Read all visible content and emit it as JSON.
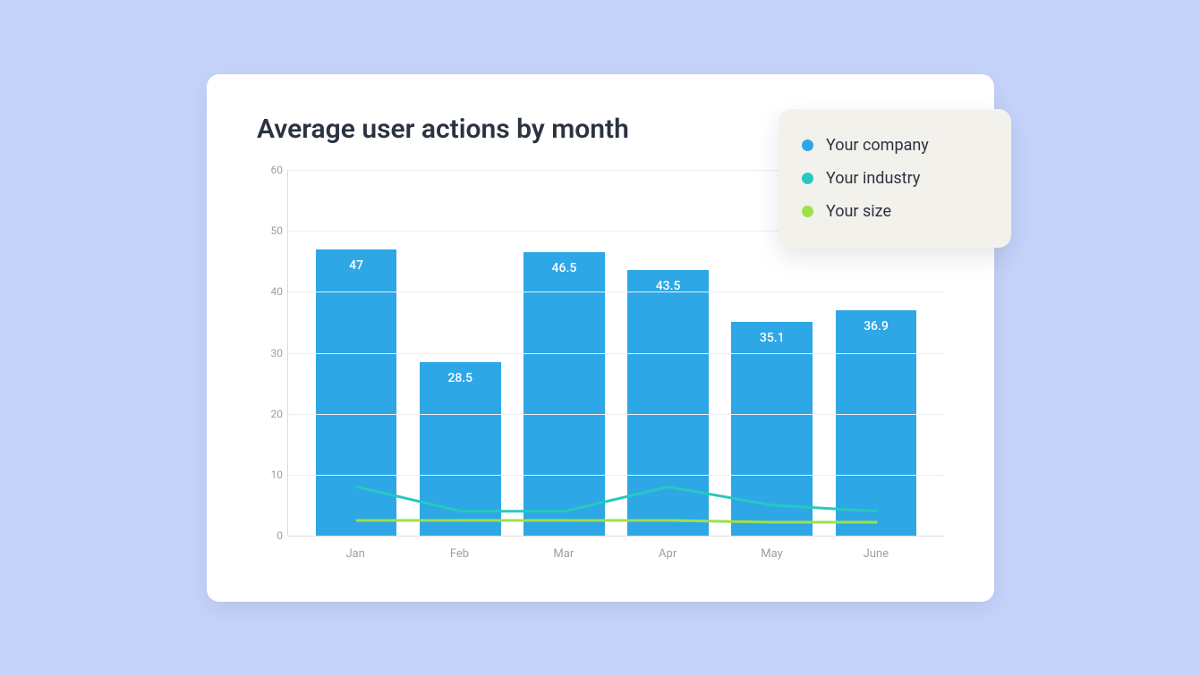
{
  "title": "Average user actions by month",
  "legend": [
    {
      "label": "Your company",
      "color": "#2ea7e6"
    },
    {
      "label": "Your industry",
      "color": "#25c9c0"
    },
    {
      "label": "Your size",
      "color": "#9de04a"
    }
  ],
  "chart_data": {
    "type": "bar",
    "title": "Average user actions by month",
    "xlabel": "",
    "ylabel": "",
    "ylim": [
      0,
      60
    ],
    "y_ticks": [
      0,
      10,
      20,
      30,
      40,
      50,
      60
    ],
    "categories": [
      "Jan",
      "Feb",
      "Mar",
      "Apr",
      "May",
      "June"
    ],
    "series": [
      {
        "name": "Your company",
        "type": "bar",
        "color": "#2ea7e6",
        "values": [
          47,
          28.5,
          46.5,
          43.5,
          35.1,
          36.9
        ]
      },
      {
        "name": "Your industry",
        "type": "line",
        "color": "#25c9c0",
        "values": [
          8,
          4,
          4,
          8,
          5,
          4
        ]
      },
      {
        "name": "Your size",
        "type": "line",
        "color": "#9de04a",
        "values": [
          2.5,
          2.5,
          2.5,
          2.5,
          2.2,
          2.2
        ]
      }
    ]
  }
}
